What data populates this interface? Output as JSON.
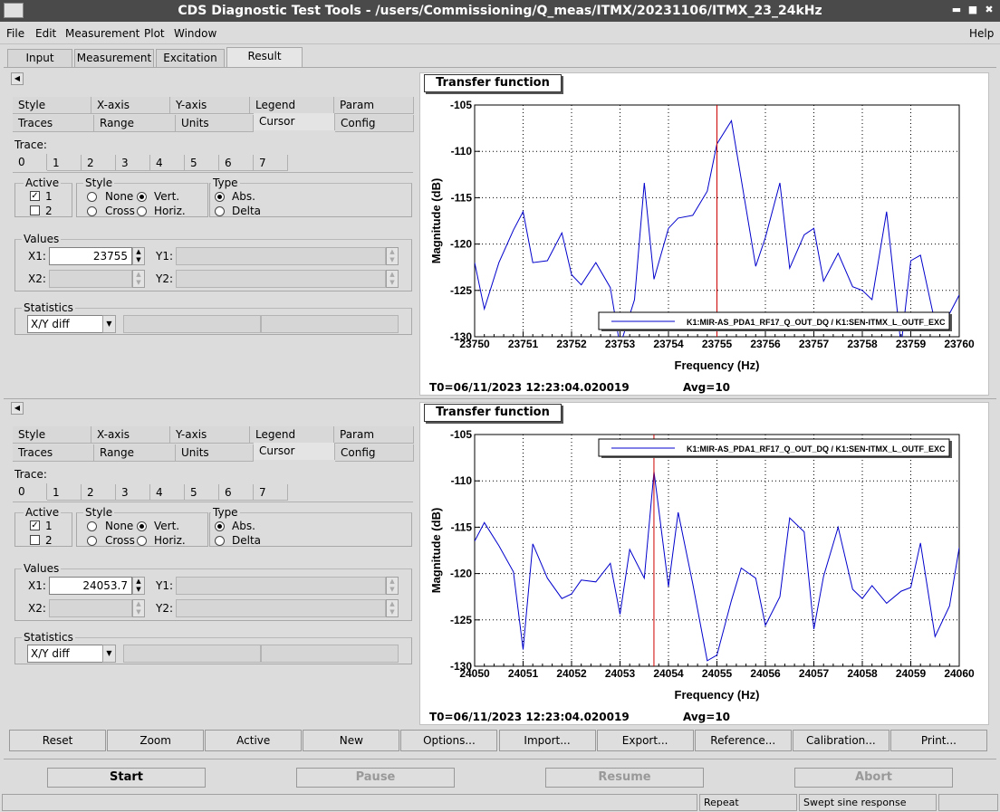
{
  "window": {
    "title": "CDS Diagnostic Test Tools - /users/Commissioning/Q_meas/ITMX/20231106/ITMX_23_24kHz"
  },
  "menu": {
    "file": "File",
    "edit": "Edit",
    "measurement": "Measurement",
    "plot": "Plot",
    "window": "Window",
    "help": "Help"
  },
  "tabs": [
    "Input",
    "Measurement",
    "Excitation",
    "Result"
  ],
  "subtabs_row1": [
    "Style",
    "X-axis",
    "Y-axis",
    "Legend",
    "Param"
  ],
  "subtabs_row2": [
    "Traces",
    "Range",
    "Units",
    "Cursor",
    "Config"
  ],
  "trace_label": "Trace:",
  "trace_tabs": [
    "0",
    "1",
    "2",
    "3",
    "4",
    "5",
    "6",
    "7"
  ],
  "active_group": {
    "label": "Active",
    "opt1": "1",
    "opt2": "2"
  },
  "style_group": {
    "label": "Style",
    "none": "None",
    "cross": "Cross",
    "vert": "Vert.",
    "horiz": "Horiz."
  },
  "type_group": {
    "label": "Type",
    "abs": "Abs.",
    "delta": "Delta"
  },
  "values_label": "Values",
  "x1_label": "X1:",
  "x2_label": "X2:",
  "y1_label": "Y1:",
  "y2_label": "Y2:",
  "statistics_label": "Statistics",
  "statistics_value": "X/Y diff",
  "panel1": {
    "x1": "23755"
  },
  "panel2": {
    "x1": "24053.7"
  },
  "plot1": {
    "title": "Transfer function",
    "legend": "K1:MIR-AS_PDA1_RF17_Q_OUT_DQ / K1:SEN-ITMX_L_OUTF_EXC",
    "footer_t0": "T0=06/11/2023 12:23:04.020019",
    "footer_avg": "Avg=10"
  },
  "plot2": {
    "title": "Transfer function",
    "legend": "K1:MIR-AS_PDA1_RF17_Q_OUT_DQ / K1:SEN-ITMX_L_OUTF_EXC",
    "footer_t0": "T0=06/11/2023 12:23:04.020019",
    "footer_avg": "Avg=10"
  },
  "chart_data": [
    {
      "type": "line",
      "title": "",
      "xlabel": "Frequency (Hz)",
      "ylabel": "Magnitude (dB)",
      "xlim": [
        23750,
        23760
      ],
      "ylim": [
        -130,
        -105
      ],
      "grid": true,
      "x_ticks": [
        "23750",
        "23751",
        "23752",
        "23753",
        "23754",
        "23755",
        "23756",
        "23757",
        "23758",
        "23759",
        "23760"
      ],
      "y_ticks": [
        "-105",
        "-110",
        "-115",
        "-120",
        "-125",
        "-130"
      ],
      "cursor_x": 23755,
      "series": [
        {
          "name": "K1:MIR-AS_PDA1_RF17_Q_OUT_DQ / K1:SEN-ITMX_L_OUTF_EXC",
          "color": "#0000cc",
          "x": [
            23750,
            23750.2,
            23750.5,
            23750.8,
            23751,
            23751.2,
            23751.5,
            23751.8,
            23752,
            23752.2,
            23752.5,
            23752.8,
            23753,
            23753.3,
            23753.5,
            23753.7,
            23754,
            23754.2,
            23754.5,
            23754.8,
            23755,
            23755.3,
            23755.5,
            23755.8,
            23756,
            23756.3,
            23756.5,
            23756.8,
            23757,
            23757.2,
            23757.5,
            23757.8,
            23758,
            23758.2,
            23758.5,
            23758.8,
            23759,
            23759.2,
            23759.5,
            23759.8,
            23760
          ],
          "y": [
            -122,
            -127,
            -122,
            -118.5,
            -116.5,
            -122,
            -121.8,
            -118.8,
            -123.3,
            -124.4,
            -122,
            -124.7,
            -131,
            -126,
            -113.4,
            -123.8,
            -118.3,
            -117.2,
            -116.9,
            -114.3,
            -109.2,
            -106.7,
            -113,
            -122.4,
            -119.3,
            -113.4,
            -122.6,
            -119,
            -118.3,
            -124,
            -121,
            -124.6,
            -125,
            -126,
            -116.5,
            -131,
            -121.8,
            -121.2,
            -128.5,
            -127.5,
            -125.5
          ]
        }
      ]
    },
    {
      "type": "line",
      "title": "",
      "xlabel": "Frequency (Hz)",
      "ylabel": "Magnitude (dB)",
      "xlim": [
        24050,
        24060
      ],
      "ylim": [
        -130,
        -105
      ],
      "grid": true,
      "x_ticks": [
        "24050",
        "24051",
        "24052",
        "24053",
        "24054",
        "24055",
        "24056",
        "24057",
        "24058",
        "24059",
        "24060"
      ],
      "y_ticks": [
        "-105",
        "-110",
        "-115",
        "-120",
        "-125",
        "-130"
      ],
      "cursor_x": 24053.7,
      "series": [
        {
          "name": "K1:MIR-AS_PDA1_RF17_Q_OUT_DQ / K1:SEN-ITMX_L_OUTF_EXC",
          "color": "#0000cc",
          "x": [
            24050,
            24050.2,
            24050.5,
            24050.8,
            24051,
            24051.2,
            24051.5,
            24051.8,
            24052,
            24052.2,
            24052.5,
            24052.8,
            24053,
            24053.2,
            24053.5,
            24053.7,
            24054,
            24054.2,
            24054.5,
            24054.8,
            24055,
            24055.3,
            24055.5,
            24055.8,
            24056,
            24056.3,
            24056.5,
            24056.8,
            24057,
            24057.2,
            24057.5,
            24057.8,
            24058,
            24058.2,
            24058.5,
            24058.8,
            24059,
            24059.2,
            24059.5,
            24059.8,
            24060
          ],
          "y": [
            -116.5,
            -114.5,
            -117,
            -119.8,
            -128.2,
            -116.8,
            -120.5,
            -122.7,
            -122.2,
            -120.7,
            -120.9,
            -118.9,
            -124.4,
            -117.4,
            -120.5,
            -109,
            -121.4,
            -113.4,
            -121.1,
            -129.4,
            -128.8,
            -122.9,
            -119.4,
            -120.5,
            -125.6,
            -122.5,
            -114,
            -115.5,
            -126,
            -120.3,
            -115,
            -121.7,
            -122.7,
            -121.3,
            -123.2,
            -121.9,
            -121.5,
            -116.7,
            -126.8,
            -123.5,
            -117.2
          ]
        }
      ]
    }
  ],
  "buttons": [
    "Reset",
    "Zoom",
    "Active",
    "New",
    "Options...",
    "Import...",
    "Export...",
    "Reference...",
    "Calibration...",
    "Print..."
  ],
  "control": {
    "start": "Start",
    "pause": "Pause",
    "resume": "Resume",
    "abort": "Abort"
  },
  "status": {
    "repeat": "Repeat",
    "mode": "Swept sine response"
  }
}
